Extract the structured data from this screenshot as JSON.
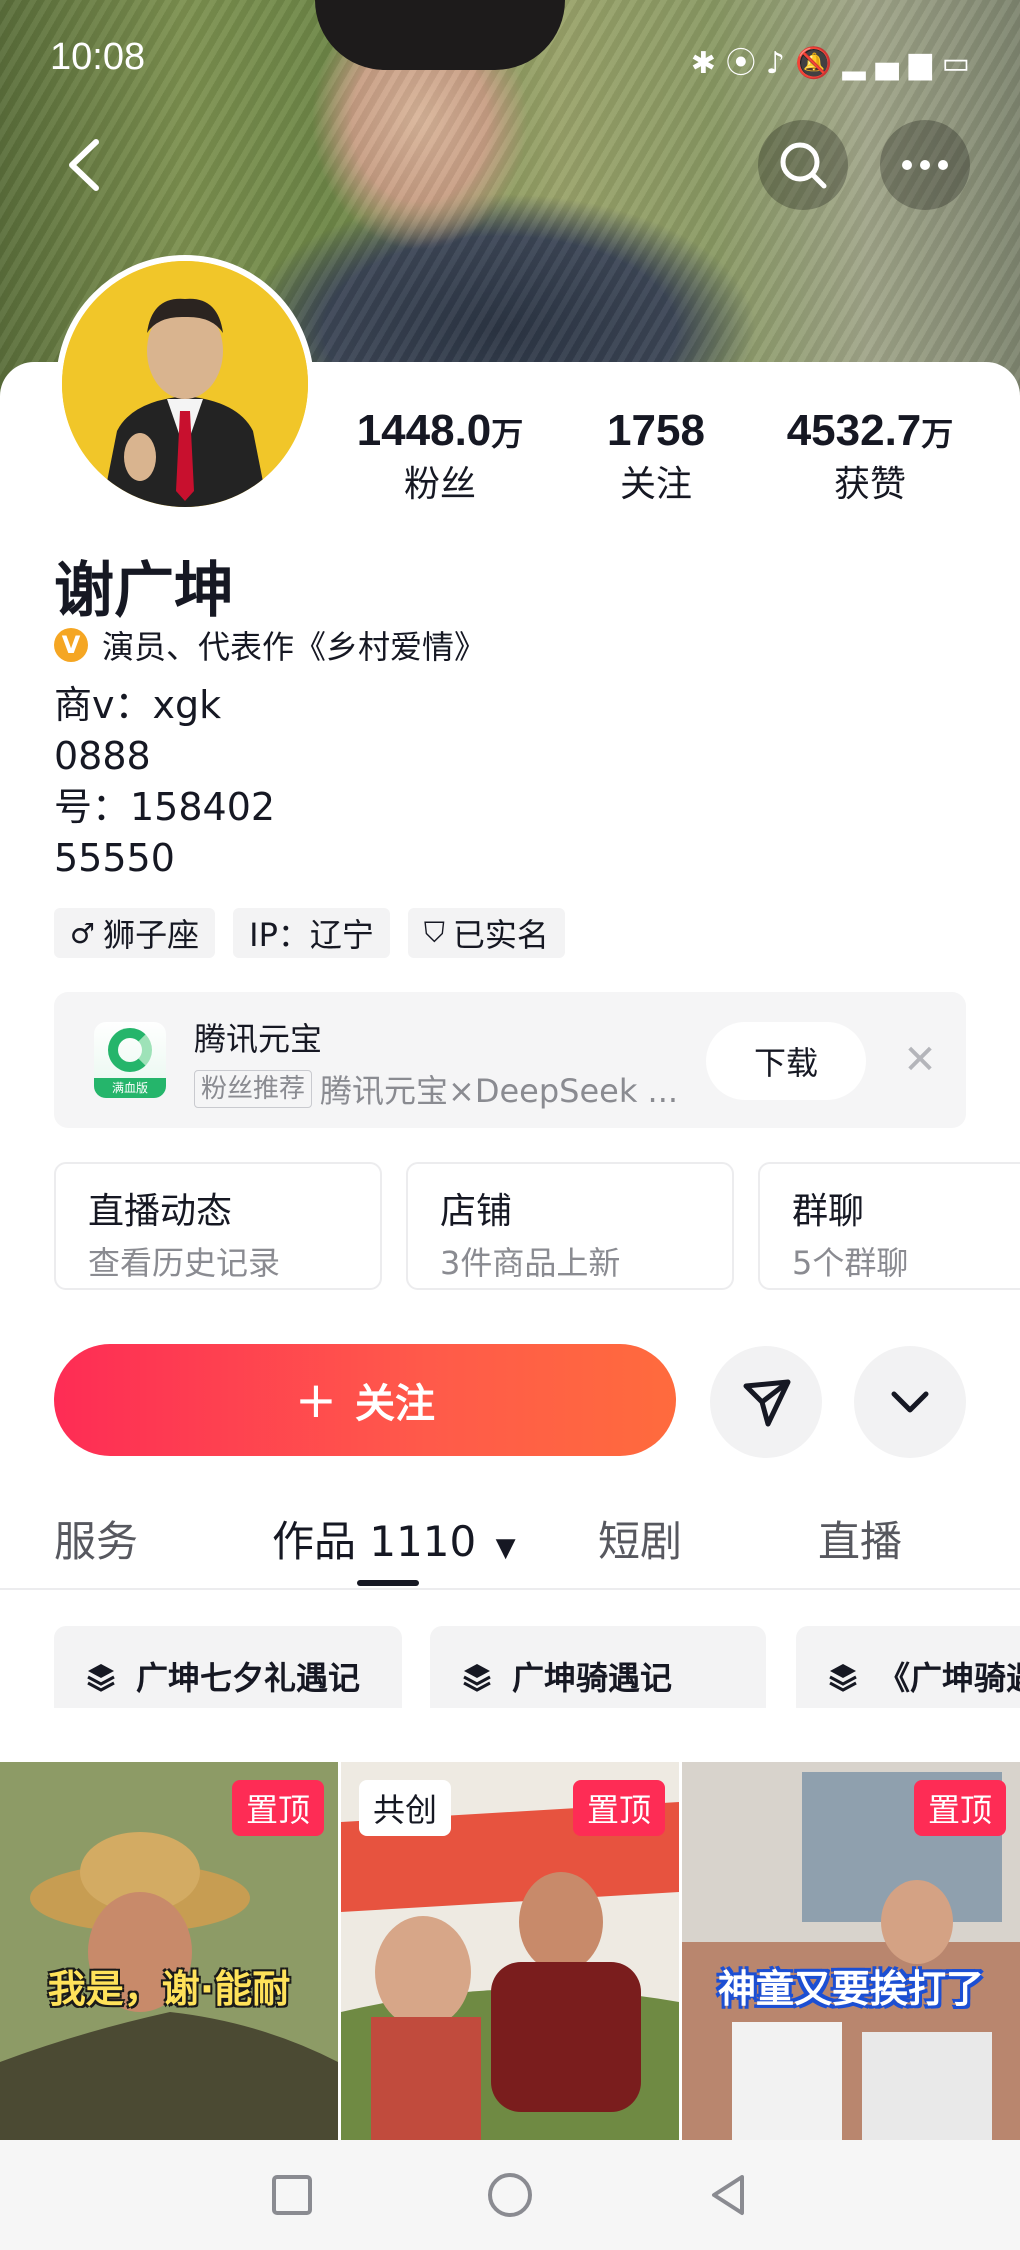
{
  "status_bar": {
    "time": "10:08"
  },
  "profile": {
    "name": "谢广坤",
    "verification": "演员、代表作《乡村爱情》",
    "bio_lines": [
      "商v：xgk",
      "0888",
      "号：158402",
      "55550"
    ]
  },
  "stats": [
    {
      "value": "1448.0",
      "unit": "万",
      "label": "粉丝"
    },
    {
      "value": "1758",
      "unit": "",
      "label": "关注"
    },
    {
      "value": "4532.7",
      "unit": "万",
      "label": "获赞"
    }
  ],
  "tags": [
    {
      "icon": "male-icon",
      "glyph": "♂",
      "label": "狮子座"
    },
    {
      "icon": "",
      "glyph": "",
      "label": "IP：辽宁"
    },
    {
      "icon": "shield-check-icon",
      "glyph": "⛉",
      "label": "已实名"
    }
  ],
  "ad": {
    "title": "腾讯元宝",
    "badge": "粉丝推荐",
    "subtitle": "腾讯元宝×DeepSeek ...",
    "logo_text": "满血版",
    "download_label": "下载",
    "close_glyph": "✕"
  },
  "shortcuts": [
    {
      "title": "直播动态",
      "subtitle": "查看历史记录"
    },
    {
      "title": "店铺",
      "subtitle": "3件商品上新"
    },
    {
      "title": "群聊",
      "subtitle": "5个群聊"
    }
  ],
  "follow_button": {
    "plus": "+",
    "label": "关注"
  },
  "tabs": [
    {
      "label": "服务"
    },
    {
      "label": "作品 1110",
      "active": true
    },
    {
      "label": "短剧"
    },
    {
      "label": "直播"
    }
  ],
  "collections": [
    {
      "label": "广坤七夕礼遇记"
    },
    {
      "label": "广坤骑遇记"
    },
    {
      "label": "《广坤骑遇"
    }
  ],
  "videos": [
    {
      "pin": "置顶",
      "badge": "",
      "caption": "我是，谢·能耐"
    },
    {
      "pin": "置顶",
      "badge": "共创",
      "caption": ""
    },
    {
      "pin": "置顶",
      "badge": "",
      "caption": "神童又要挨打了"
    }
  ],
  "colors": {
    "accent": "#fe2c55",
    "accent_end": "#ff6b3d",
    "verify_badge": "#f5a623"
  }
}
